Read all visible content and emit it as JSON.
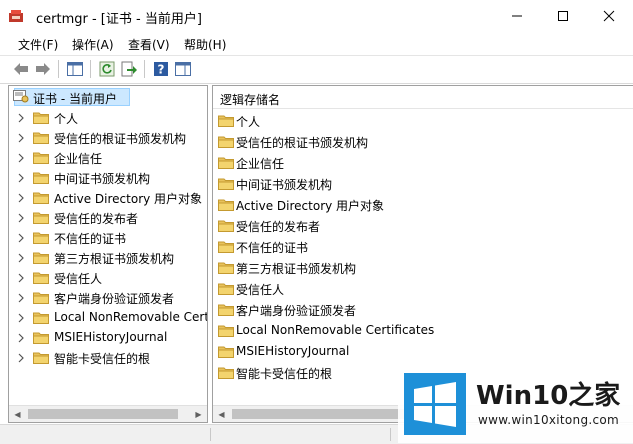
{
  "window": {
    "title": "certmgr - [证书 - 当前用户]"
  },
  "menu": [
    "文件(F)",
    "操作(A)",
    "查看(V)",
    "帮助(H)"
  ],
  "tree": {
    "root": "证书 - 当前用户",
    "items": [
      "个人",
      "受信任的根证书颁发机构",
      "企业信任",
      "中间证书颁发机构",
      "Active Directory 用户对象",
      "受信任的发布者",
      "不信任的证书",
      "第三方根证书颁发机构",
      "受信任人",
      "客户端身份验证颁发者",
      "Local NonRemovable Cert",
      "MSIEHistoryJournal",
      "智能卡受信任的根"
    ]
  },
  "list": {
    "header": "逻辑存储名",
    "items": [
      "个人",
      "受信任的根证书颁发机构",
      "企业信任",
      "中间证书颁发机构",
      "Active Directory 用户对象",
      "受信任的发布者",
      "不信任的证书",
      "第三方根证书颁发机构",
      "受信任人",
      "客户端身份验证颁发者",
      "Local NonRemovable Certificates",
      "MSIEHistoryJournal",
      "智能卡受信任的根"
    ]
  },
  "watermark": {
    "brand": "Win10之家",
    "url": "www.win10xitong.com"
  },
  "colors": {
    "folder": "#e8c25c",
    "selection": "#cce8ff",
    "logo_blue": "#1e90d8"
  }
}
